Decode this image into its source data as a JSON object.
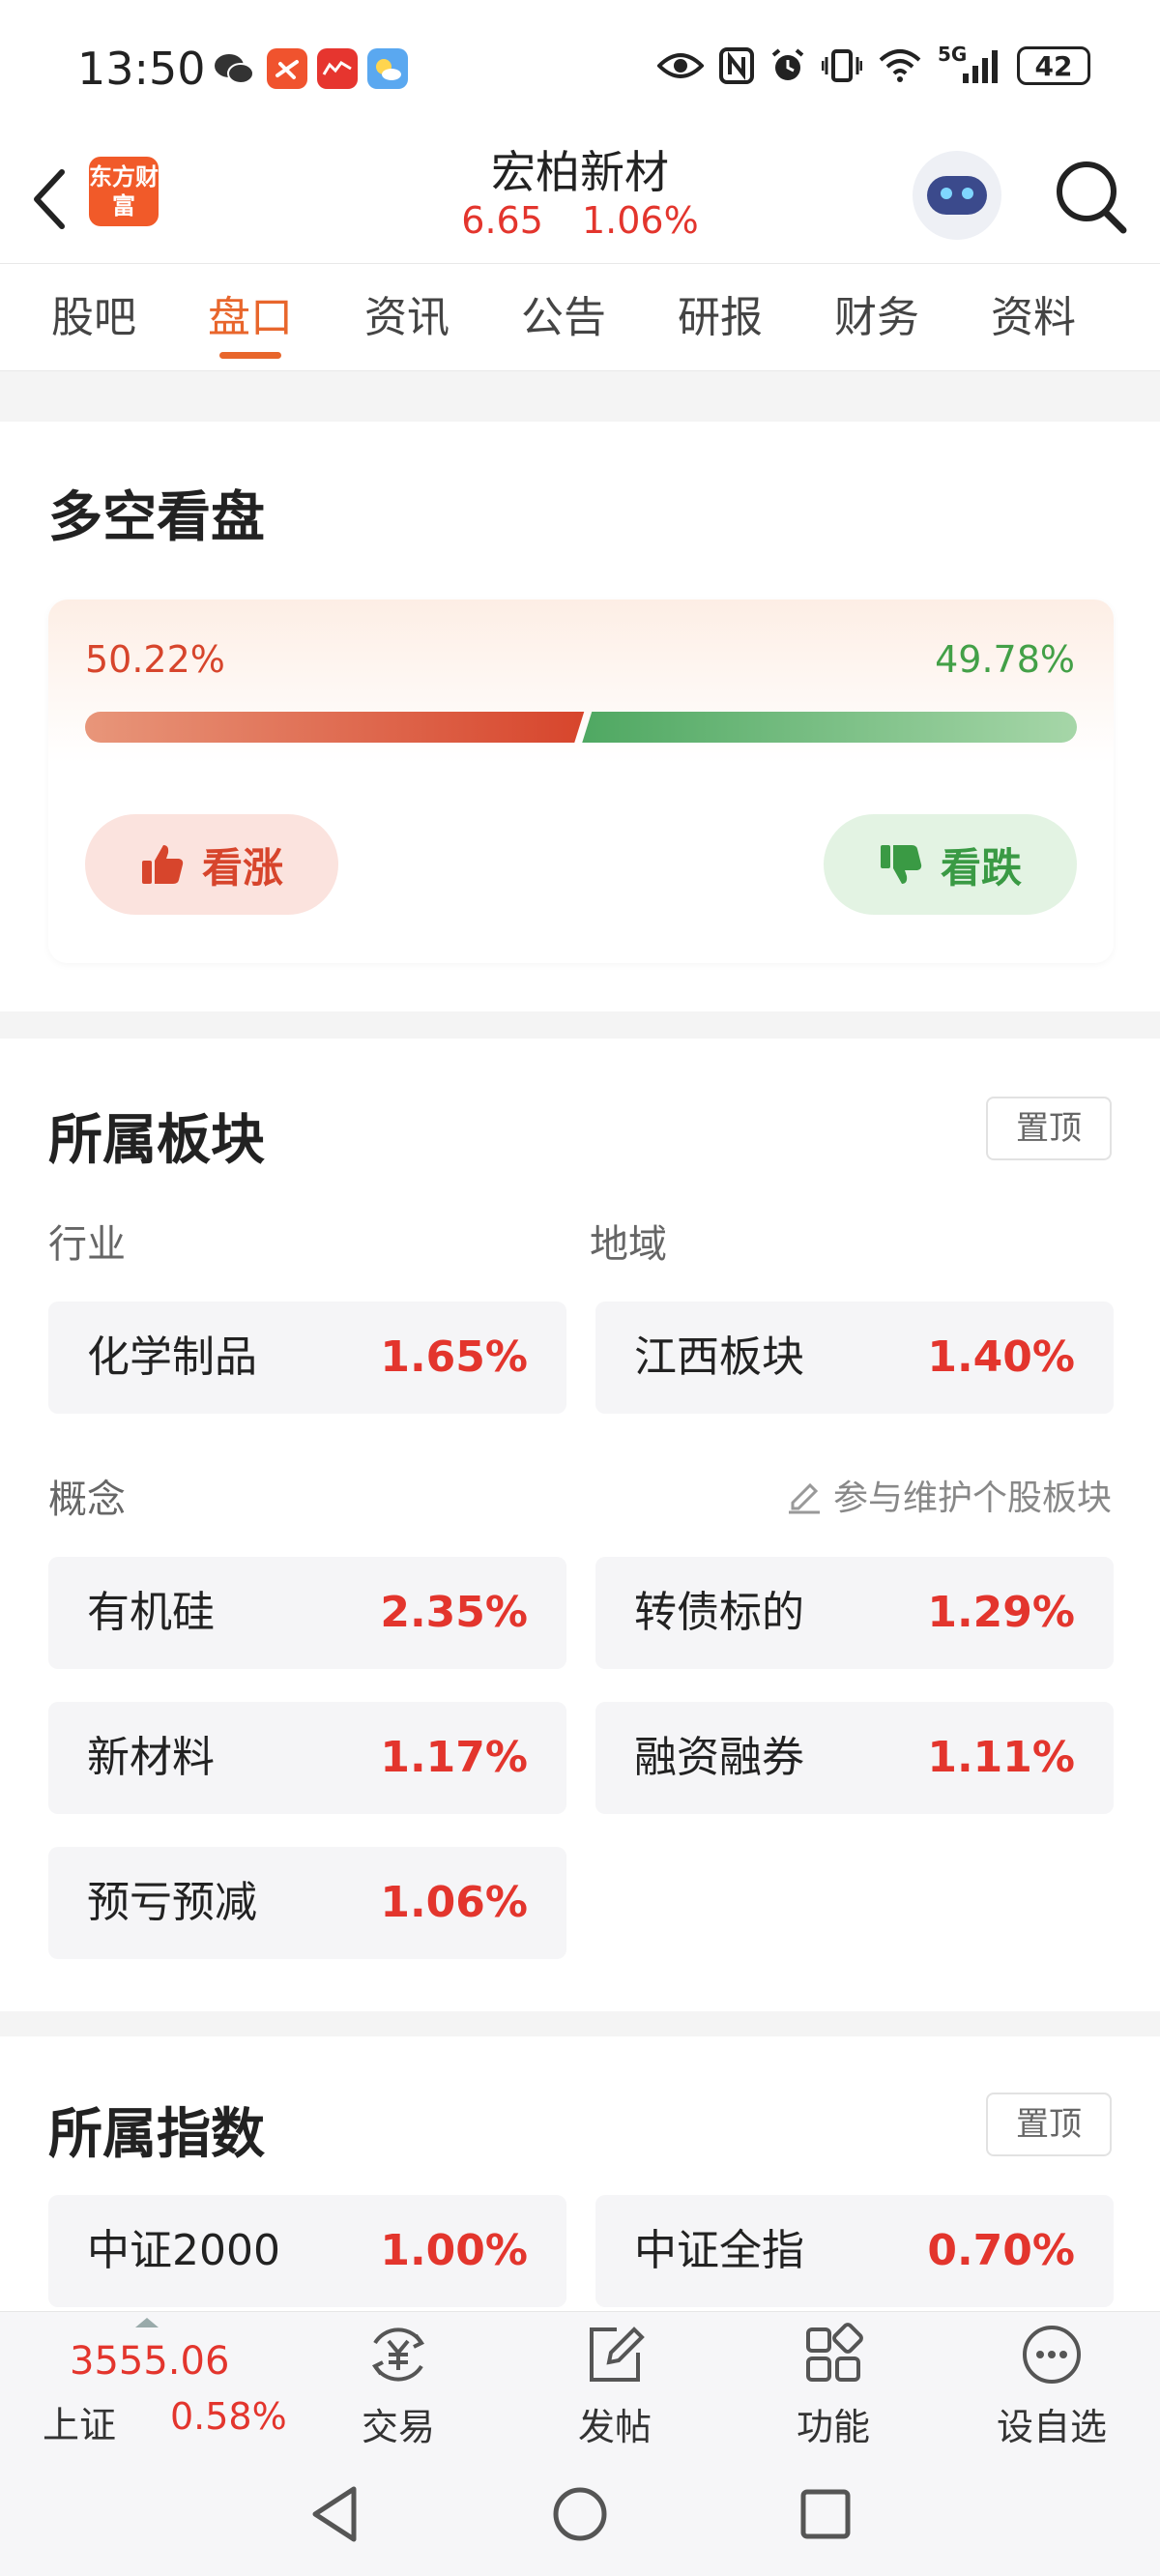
{
  "status_bar": {
    "time": "13:50",
    "network": "5G",
    "battery": "42",
    "icons": [
      "wechat-icon",
      "app-icon",
      "app-icon",
      "weather-icon",
      "eye-icon",
      "nfc-icon",
      "alarm-icon",
      "vibrate-icon",
      "wifi-icon",
      "signal-icon",
      "battery-icon"
    ]
  },
  "header": {
    "logo_text": "东方财富",
    "stock_name": "宏柏新材",
    "price": "6.65",
    "change_pct": "1.06%"
  },
  "tabs": [
    {
      "label": "股吧"
    },
    {
      "label": "盘口"
    },
    {
      "label": "资讯"
    },
    {
      "label": "公告"
    },
    {
      "label": "研报"
    },
    {
      "label": "财务"
    },
    {
      "label": "资料"
    }
  ],
  "active_tab": "盘口",
  "sentiment": {
    "title": "多空看盘",
    "bull_pct": "50.22%",
    "bear_pct": "49.78%",
    "bull_fraction": 0.5022,
    "bull_label": "看涨",
    "bear_label": "看跌",
    "bull_color": "#d7452c",
    "bear_color": "#43a047"
  },
  "sectors": {
    "title": "所属板块",
    "pin_label": "置顶",
    "industry_label": "行业",
    "region_label": "地域",
    "industry": {
      "name": "化学制品",
      "pct": "1.65%"
    },
    "region": {
      "name": "江西板块",
      "pct": "1.40%"
    },
    "concept_label": "概念",
    "maintain_label": "参与维护个股板块",
    "concepts": [
      {
        "name": "有机硅",
        "pct": "2.35%"
      },
      {
        "name": "转债标的",
        "pct": "1.29%"
      },
      {
        "name": "新材料",
        "pct": "1.17%"
      },
      {
        "name": "融资融券",
        "pct": "1.11%"
      },
      {
        "name": "预亏预减",
        "pct": "1.06%"
      }
    ]
  },
  "indices": {
    "title": "所属指数",
    "pin_label": "置顶",
    "items": [
      {
        "name": "中证2000",
        "pct": "1.00%"
      },
      {
        "name": "中证全指",
        "pct": "0.70%"
      }
    ]
  },
  "bottom_bar": {
    "index_value": "3555.06",
    "index_name": "上证",
    "index_pct": "0.58%",
    "nav": [
      {
        "label": "交易",
        "icon": "yuan-cycle-icon"
      },
      {
        "label": "发帖",
        "icon": "edit-icon"
      },
      {
        "label": "功能",
        "icon": "grid-icon"
      },
      {
        "label": "设自选",
        "icon": "more-icon"
      }
    ]
  },
  "accent_color": "#e8662c",
  "up_color": "#e3352d"
}
